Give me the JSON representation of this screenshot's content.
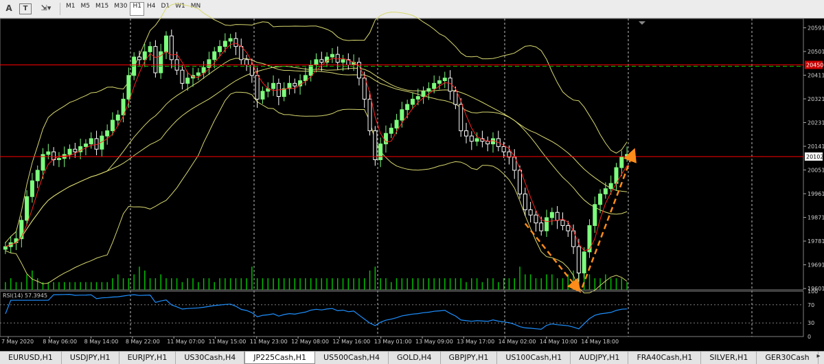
{
  "toolbar": {
    "icons": [
      "text-tool-icon",
      "text-label-icon",
      "arrows-tool-icon"
    ],
    "timeframes": [
      "M1",
      "M5",
      "M15",
      "M30",
      "H1",
      "H4",
      "D1",
      "W1",
      "MN"
    ],
    "active_timeframe": "H1"
  },
  "tabs": [
    "EURUSD,H1",
    "USDJPY,H1",
    "EURJPY,H1",
    "US30Cash,H4",
    "JP225Cash,H1",
    "US500Cash,H4",
    "GOLD,H4",
    "GBPJPY,H1",
    "US100Cash,H1",
    "AUDJPY,H1",
    "FRA40Cash,H1",
    "SILVER,H1",
    "GER30Cash"
  ],
  "active_tab": "JP225Cash,H1",
  "colors": {
    "background": "#000000",
    "bull_candle": "#7dff7d",
    "bear_candle": "#ffffff",
    "volume": "#00c000",
    "bollinger": "#d8d870",
    "ma_red": "#ff2020",
    "rsi": "#1e90ff",
    "arrow": "#ff8c1a",
    "hline": "#ff0000"
  },
  "chart_data": {
    "type": "line",
    "symbol": "JP225Cash,H1",
    "price_axis_ticks": [
      "20591",
      "20501",
      "20411",
      "20321",
      "20231",
      "20141",
      "20051",
      "19961",
      "19871",
      "19781",
      "19691",
      "19601"
    ],
    "ylim": [
      19596,
      20626
    ],
    "horizontal_lines": [
      {
        "value": "20450",
        "label": "20450"
      },
      {
        "value": "20102",
        "label": "20102"
      }
    ],
    "current_price": "20102",
    "time_axis_labels": [
      "7 May 2020",
      "8 May 06:00",
      "8 May 14:00",
      "8 May 22:00",
      "11 May 07:00",
      "11 May 15:00",
      "11 May 23:00",
      "12 May 08:00",
      "12 May 16:00",
      "13 May 01:00",
      "13 May 09:00",
      "13 May 17:00",
      "14 May 02:00",
      "14 May 10:00",
      "14 May 18:00"
    ],
    "close_series": [
      19760,
      19775,
      19790,
      19860,
      19950,
      20010,
      20050,
      20110,
      20120,
      20090,
      20095,
      20110,
      20130,
      20120,
      20140,
      20150,
      20170,
      20130,
      20180,
      20200,
      20240,
      20260,
      20320,
      20410,
      20480,
      20470,
      20500,
      20520,
      20420,
      20500,
      20560,
      20470,
      20430,
      20380,
      20400,
      20410,
      20420,
      20440,
      20470,
      20500,
      20520,
      20540,
      20550,
      20520,
      20470,
      20450,
      20410,
      20320,
      20350,
      20360,
      20380,
      20330,
      20360,
      20380,
      20370,
      20390,
      20410,
      20450,
      20470,
      20460,
      20480,
      20490,
      20460,
      20470,
      20450,
      20460,
      20400,
      20320,
      20200,
      20090,
      20150,
      20190,
      20210,
      20240,
      20280,
      20300,
      20320,
      20330,
      20350,
      20360,
      20380,
      20390,
      20400,
      20350,
      20300,
      20200,
      20180,
      20160,
      20170,
      20160,
      20150,
      20170,
      20140,
      20120,
      20100,
      20050,
      19960,
      19900,
      19880,
      19850,
      19820,
      19870,
      19890,
      19860,
      19840,
      19820,
      19760,
      19660,
      19740,
      19840,
      19920,
      19960,
      19980,
      20000,
      20060,
      20100,
      20110
    ],
    "volume_series": [
      2,
      3,
      2,
      2,
      4,
      5,
      3,
      2,
      2,
      2,
      2,
      2,
      2,
      2,
      2,
      2,
      2,
      2,
      2,
      2,
      3,
      4,
      3,
      3,
      4,
      6,
      5,
      3,
      3,
      4,
      3,
      3,
      3,
      2,
      3,
      3,
      2,
      3,
      3,
      2,
      3,
      3,
      3,
      3,
      3,
      3,
      6,
      3,
      3,
      3,
      3,
      3,
      3,
      3,
      3,
      3,
      3,
      3,
      3,
      3,
      3,
      3,
      3,
      3,
      3,
      3,
      3,
      3,
      5,
      6,
      3,
      3,
      2,
      3,
      3,
      3,
      3,
      3,
      3,
      3,
      3,
      3,
      3,
      3,
      3,
      3,
      2,
      3,
      3,
      2,
      3,
      3,
      2,
      3,
      3,
      3,
      6,
      4,
      4,
      3,
      3,
      4,
      4,
      3,
      3,
      4,
      5,
      8,
      6,
      4,
      3,
      3,
      4,
      3,
      3,
      3,
      2
    ],
    "rsi": {
      "label": "RSI(14) 57.3945",
      "levels": [
        "70",
        "30"
      ],
      "scale_ticks": [
        "100",
        "70",
        "30",
        "0"
      ]
    },
    "annotations": [
      {
        "type": "arrow",
        "direction": "down",
        "description": "orange dashed arrow"
      },
      {
        "type": "arrow",
        "direction": "up",
        "description": "orange dashed arrow"
      }
    ],
    "grid": "vertical dashed"
  }
}
